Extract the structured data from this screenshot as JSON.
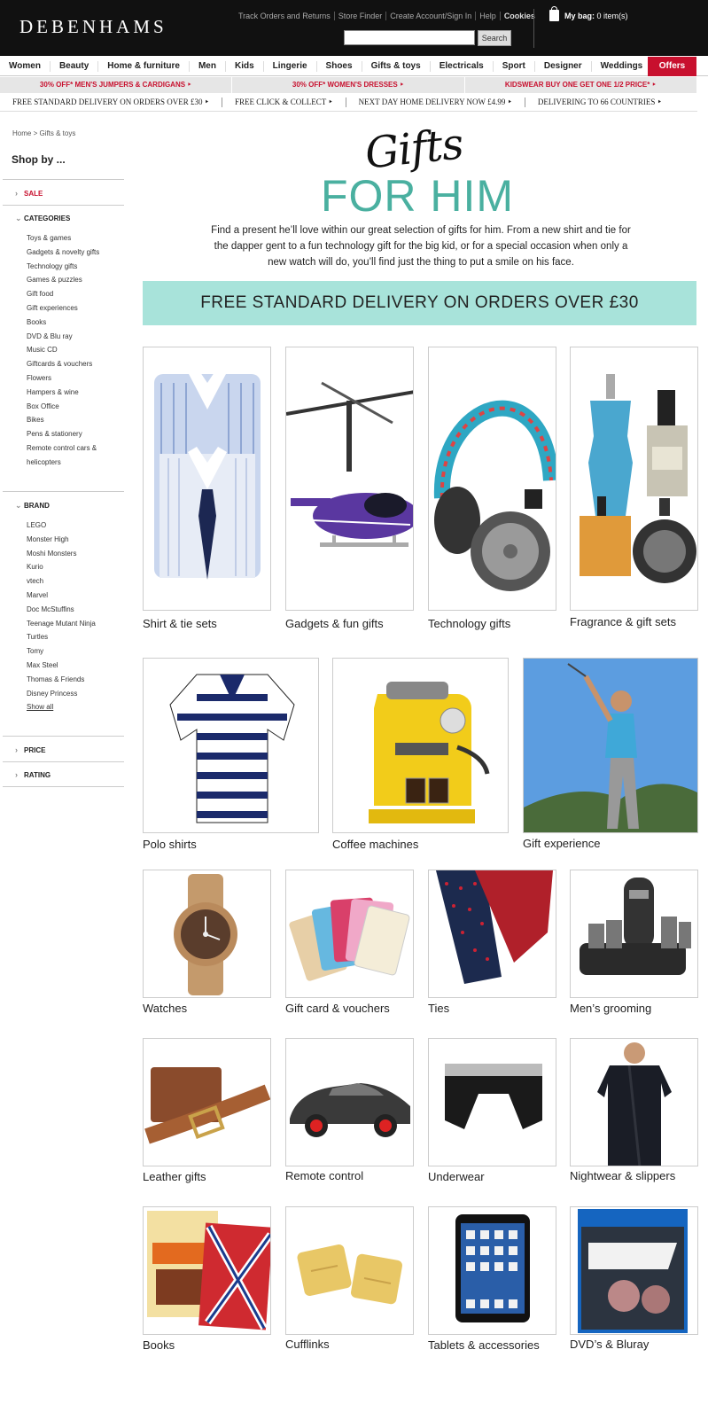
{
  "header": {
    "logo": "DEBENHAMS",
    "links": [
      "Track Orders and Returns",
      "Store Finder",
      "Create Account/Sign In",
      "Help",
      "Cookies"
    ],
    "search_placeholder": "",
    "search_button": "Search",
    "bag_label": "My bag:",
    "bag_count": "0 item(s)"
  },
  "nav": {
    "items": [
      "Women",
      "Beauty",
      "Home & furniture",
      "Men",
      "Kids",
      "Lingerie",
      "Shoes",
      "Gifts & toys",
      "Electricals",
      "Sport",
      "Designer",
      "Weddings"
    ],
    "offers": "Offers"
  },
  "promos": [
    "30% OFF* MEN'S JUMPERS & CARDIGANS ‣",
    "30% OFF* WOMEN'S DRESSES ‣",
    "KIDSWEAR BUY ONE GET ONE 1/2 PRICE* ‣"
  ],
  "delivery": [
    "FREE STANDARD DELIVERY ON ORDERS OVER £30 ‣",
    "FREE CLICK & COLLECT ‣",
    "NEXT DAY HOME DELIVERY NOW £4.99 ‣",
    "DELIVERING TO 66 COUNTRIES ‣"
  ],
  "sidebar": {
    "breadcrumb": "Home > Gifts & toys",
    "shop_by": "Shop by ...",
    "sale": "SALE",
    "categories_title": "CATEGORIES",
    "categories": [
      "Toys & games",
      "Gadgets & novelty gifts",
      "Technology gifts",
      "Games & puzzles",
      "Gift food",
      "Gift experiences",
      "Books",
      "DVD & Blu ray",
      "Music CD",
      "Giftcards & vouchers",
      "Flowers",
      "Hampers & wine",
      "Box Office",
      "Bikes",
      "Pens & stationery",
      "Remote control cars &",
      "helicopters"
    ],
    "brand_title": "BRAND",
    "brands": [
      "LEGO",
      "Monster High",
      "Moshi Monsters",
      "Kurio",
      "vtech",
      "Marvel",
      "Doc McStuffins",
      "Teenage Mutant Ninja",
      "Turtles",
      "Tomy",
      "Max Steel",
      "Thomas & Friends",
      "Disney Princess"
    ],
    "show_all": "Show all",
    "price": "PRICE",
    "rating": "RATING"
  },
  "hero": {
    "script_title": "Gifts",
    "title": "FOR HIM",
    "intro": "Find a present he’ll love within our great selection of gifts for him. From a new shirt and tie for the dapper gent to a fun technology gift for the big kid, or for a special occasion when only a new watch will do, you’ll find just the thing to put a smile on his face.",
    "banner": "FREE STANDARD DELIVERY ON ORDERS OVER £30"
  },
  "tiles": [
    {
      "caption": "Shirt & tie sets",
      "icon": "shirt-icon"
    },
    {
      "caption": "Gadgets & fun gifts",
      "icon": "helicopter-icon"
    },
    {
      "caption": "Technology gifts",
      "icon": "headphones-icon"
    },
    {
      "caption": "Fragrance & gift sets",
      "icon": "fragrance-icon"
    },
    {
      "caption": "Polo shirts",
      "icon": "polo-icon"
    },
    {
      "caption": "Coffee machines",
      "icon": "coffee-machine-icon"
    },
    {
      "caption": "Gift experience",
      "icon": "golfer-icon"
    },
    {
      "caption": "Watches",
      "icon": "watch-icon"
    },
    {
      "caption": "Gift card & vouchers",
      "icon": "gift-card-icon"
    },
    {
      "caption": "Ties",
      "icon": "tie-icon"
    },
    {
      "caption": "Men’s grooming",
      "icon": "trimmer-icon"
    },
    {
      "caption": "Leather gifts",
      "icon": "belt-icon"
    },
    {
      "caption": "Remote control",
      "icon": "car-icon"
    },
    {
      "caption": "Underwear",
      "icon": "underwear-icon"
    },
    {
      "caption": "Nightwear & slippers",
      "icon": "robe-icon"
    },
    {
      "caption": "Books",
      "icon": "books-icon"
    },
    {
      "caption": "Cufflinks",
      "icon": "cufflinks-icon"
    },
    {
      "caption": "Tablets & accessories",
      "icon": "tablet-icon"
    },
    {
      "caption": "DVD’s & Bluray",
      "icon": "dvd-icon"
    }
  ]
}
